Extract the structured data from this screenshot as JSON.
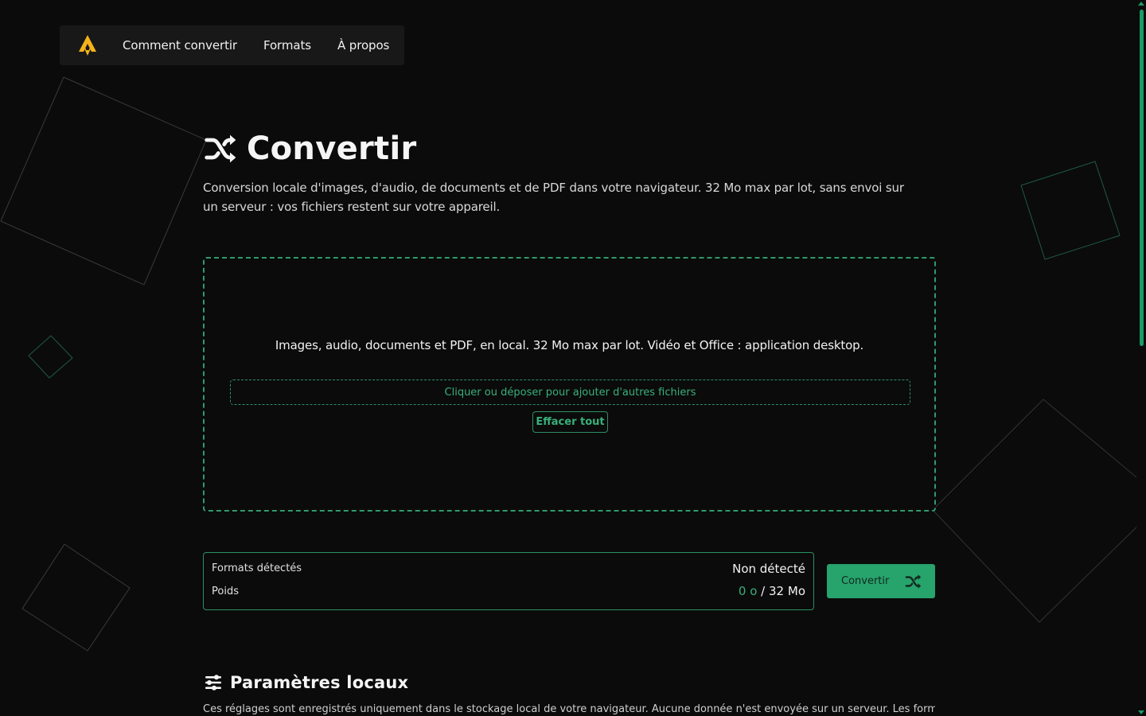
{
  "nav": {
    "logo_icon": "rocket-a-logo-icon",
    "links": [
      "Comment convertir",
      "Formats",
      "À propos"
    ]
  },
  "hero": {
    "title_icon": "shuffle-icon",
    "title": "Convertir",
    "subtitle": "Conversion locale d'images, d'audio, de documents et de PDF dans votre navigateur. 32 Mo max par lot, sans envoi sur un serveur : vos fichiers restent sur votre appareil."
  },
  "dropzone": {
    "text": "Images, audio, documents et PDF, en local. 32 Mo max par lot. Vidéo et Office : application desktop.",
    "add_label": "Cliquer ou déposer pour ajouter d'autres fichiers",
    "clear_label": "Effacer tout"
  },
  "info": {
    "formats_label": "Formats détectés",
    "formats_value": "Non détecté",
    "weight_label": "Poids",
    "weight_used": "0 o",
    "weight_separator": "/",
    "weight_max": "32 Mo"
  },
  "convert": {
    "label": "Convertir",
    "icon": "shuffle-icon"
  },
  "settings": {
    "icon": "sliders-icon",
    "title": "Paramètres locaux",
    "desc": "Ces réglages sont enregistrés uniquement dans le stockage local de votre navigateur. Aucune donnée n'est envoyée sur un serveur. Les formats"
  },
  "colors": {
    "accent": "#27a36c",
    "accent_text": "#38b07a",
    "background": "#0b0b0b",
    "logo": "#f5b21b"
  }
}
